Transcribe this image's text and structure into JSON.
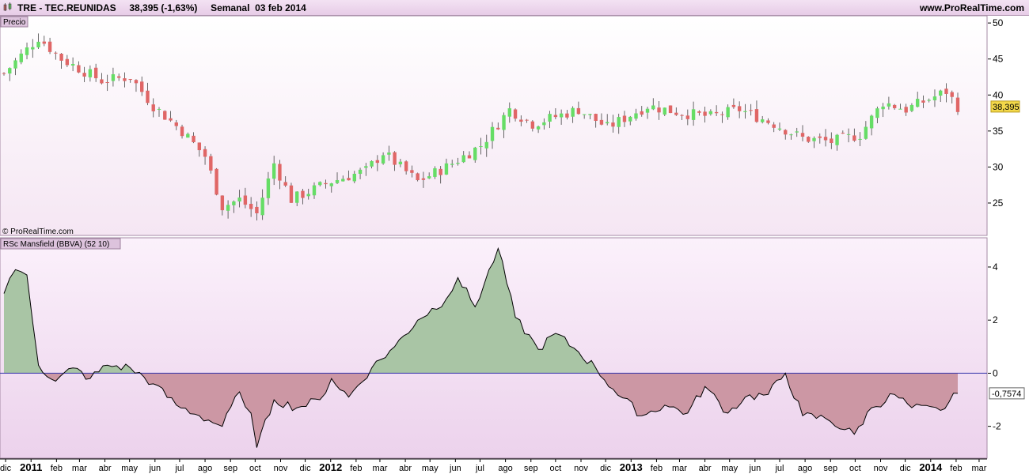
{
  "header": {
    "symbol": "TRE - TEC.REUNIDAS",
    "price_change": "38,395 (-1,63%)",
    "period": "Semanal",
    "date": "03 feb 2014",
    "site": "www.ProRealTime.com"
  },
  "price_panel": {
    "label": "Precio",
    "copyright": "© ProRealTime.com",
    "last_value_label": "38,395",
    "y_ticks": [
      "50",
      "45",
      "40",
      "35",
      "30",
      "25"
    ]
  },
  "indicator_panel": {
    "label": "RSc Mansfield (BBVA) (52 10)",
    "last_value_label": "-0,7574",
    "y_ticks": [
      "4",
      "2",
      "0",
      "-2"
    ]
  },
  "x_axis_labels": [
    "dic",
    "2011",
    "feb",
    "mar",
    "abr",
    "may",
    "jun",
    "jul",
    "ago",
    "sep",
    "oct",
    "nov",
    "dic",
    "2012",
    "feb",
    "mar",
    "abr",
    "may",
    "jun",
    "jul",
    "ago",
    "sep",
    "oct",
    "nov",
    "dic",
    "2013",
    "feb",
    "mar",
    "abr",
    "may",
    "jun",
    "jul",
    "ago",
    "sep",
    "oct",
    "nov",
    "dic",
    "2014",
    "feb",
    "mar"
  ],
  "chart_data": [
    {
      "type": "candlestick",
      "title": "Precio",
      "period": "weekly",
      "x_range": [
        "2010-11-29",
        "2014-02-03"
      ],
      "ylim": [
        20.5,
        51
      ],
      "last_close": 38.395,
      "change_pct": -1.63,
      "colors": {
        "up": "#66dd66",
        "down": "#e06666",
        "wick": "#444444"
      },
      "keypoints": [
        {
          "date": "2010-11-29",
          "close": 43.0
        },
        {
          "date": "2011-01-10",
          "close": 48.0
        },
        {
          "date": "2011-02-07",
          "close": 45.0
        },
        {
          "date": "2011-03-28",
          "close": 42.0
        },
        {
          "date": "2011-05-02",
          "close": 42.5
        },
        {
          "date": "2011-05-30",
          "close": 38.5
        },
        {
          "date": "2011-07-04",
          "close": 35.0
        },
        {
          "date": "2011-08-01",
          "close": 31.5
        },
        {
          "date": "2011-08-22",
          "close": 24.5
        },
        {
          "date": "2011-09-12",
          "close": 25.5
        },
        {
          "date": "2011-10-03",
          "close": 23.5
        },
        {
          "date": "2011-10-24",
          "close": 30.5
        },
        {
          "date": "2011-11-14",
          "close": 25.5
        },
        {
          "date": "2012-01-02",
          "close": 28.0
        },
        {
          "date": "2012-02-13",
          "close": 29.5
        },
        {
          "date": "2012-03-05",
          "close": 32.0
        },
        {
          "date": "2012-04-16",
          "close": 28.0
        },
        {
          "date": "2012-05-21",
          "close": 30.0
        },
        {
          "date": "2012-07-02",
          "close": 33.0
        },
        {
          "date": "2012-08-06",
          "close": 38.0
        },
        {
          "date": "2012-09-03",
          "close": 36.0
        },
        {
          "date": "2012-10-29",
          "close": 38.0
        },
        {
          "date": "2012-12-03",
          "close": 35.5
        },
        {
          "date": "2013-01-21",
          "close": 38.5
        },
        {
          "date": "2013-03-04",
          "close": 37.5
        },
        {
          "date": "2013-04-08",
          "close": 37.0
        },
        {
          "date": "2013-05-13",
          "close": 38.0
        },
        {
          "date": "2013-06-24",
          "close": 36.0
        },
        {
          "date": "2013-07-29",
          "close": 34.0
        },
        {
          "date": "2013-09-02",
          "close": 33.5
        },
        {
          "date": "2013-10-07",
          "close": 34.5
        },
        {
          "date": "2013-11-04",
          "close": 39.0
        },
        {
          "date": "2013-12-02",
          "close": 38.0
        },
        {
          "date": "2014-01-20",
          "close": 40.5
        },
        {
          "date": "2014-02-03",
          "close": 38.395
        }
      ]
    },
    {
      "type": "area",
      "title": "RSc Mansfield (BBVA) (52 10)",
      "ylim": [
        -3.2,
        5.1
      ],
      "last_value": -0.7574,
      "baseline": 0,
      "colors": {
        "positive_fill": "#a9c5a5",
        "negative_fill": "#cc97a4",
        "line": "#000000",
        "zero_line": "#3333aa"
      },
      "keypoints": [
        {
          "date": "2010-11-29",
          "value": 3.0
        },
        {
          "date": "2010-12-13",
          "value": 3.9
        },
        {
          "date": "2010-12-27",
          "value": 3.7
        },
        {
          "date": "2011-01-10",
          "value": 0.3
        },
        {
          "date": "2011-01-31",
          "value": -0.3
        },
        {
          "date": "2011-02-21",
          "value": 0.2
        },
        {
          "date": "2011-03-14",
          "value": -0.2
        },
        {
          "date": "2011-04-04",
          "value": 0.3
        },
        {
          "date": "2011-05-02",
          "value": 0.2
        },
        {
          "date": "2011-05-30",
          "value": -0.4
        },
        {
          "date": "2011-06-27",
          "value": -1.2
        },
        {
          "date": "2011-07-25",
          "value": -1.6
        },
        {
          "date": "2011-08-22",
          "value": -2.0
        },
        {
          "date": "2011-09-12",
          "value": -0.7
        },
        {
          "date": "2011-09-26",
          "value": -1.5
        },
        {
          "date": "2011-10-03",
          "value": -2.8
        },
        {
          "date": "2011-10-24",
          "value": -1.0
        },
        {
          "date": "2011-11-21",
          "value": -1.3
        },
        {
          "date": "2011-12-19",
          "value": -1.0
        },
        {
          "date": "2012-01-02",
          "value": -0.2
        },
        {
          "date": "2012-01-23",
          "value": -0.9
        },
        {
          "date": "2012-02-20",
          "value": 0.2
        },
        {
          "date": "2012-03-19",
          "value": 1.0
        },
        {
          "date": "2012-04-16",
          "value": 2.0
        },
        {
          "date": "2012-05-21",
          "value": 2.8
        },
        {
          "date": "2012-06-04",
          "value": 3.6
        },
        {
          "date": "2012-06-25",
          "value": 2.5
        },
        {
          "date": "2012-07-23",
          "value": 4.7
        },
        {
          "date": "2012-08-13",
          "value": 2.1
        },
        {
          "date": "2012-09-10",
          "value": 0.9
        },
        {
          "date": "2012-10-01",
          "value": 1.5
        },
        {
          "date": "2012-10-29",
          "value": 0.8
        },
        {
          "date": "2012-11-19",
          "value": 0.2
        },
        {
          "date": "2012-12-10",
          "value": -0.6
        },
        {
          "date": "2013-01-14",
          "value": -1.6
        },
        {
          "date": "2013-02-11",
          "value": -1.2
        },
        {
          "date": "2013-03-11",
          "value": -1.5
        },
        {
          "date": "2013-04-01",
          "value": -0.5
        },
        {
          "date": "2013-04-29",
          "value": -1.5
        },
        {
          "date": "2013-05-20",
          "value": -0.9
        },
        {
          "date": "2013-06-17",
          "value": -0.8
        },
        {
          "date": "2013-07-08",
          "value": 0.0
        },
        {
          "date": "2013-07-29",
          "value": -1.6
        },
        {
          "date": "2013-08-26",
          "value": -1.7
        },
        {
          "date": "2013-09-30",
          "value": -2.3
        },
        {
          "date": "2013-10-21",
          "value": -1.3
        },
        {
          "date": "2013-11-18",
          "value": -0.8
        },
        {
          "date": "2013-12-09",
          "value": -1.3
        },
        {
          "date": "2014-01-13",
          "value": -1.4
        },
        {
          "date": "2014-02-03",
          "value": -0.7574
        }
      ]
    }
  ]
}
